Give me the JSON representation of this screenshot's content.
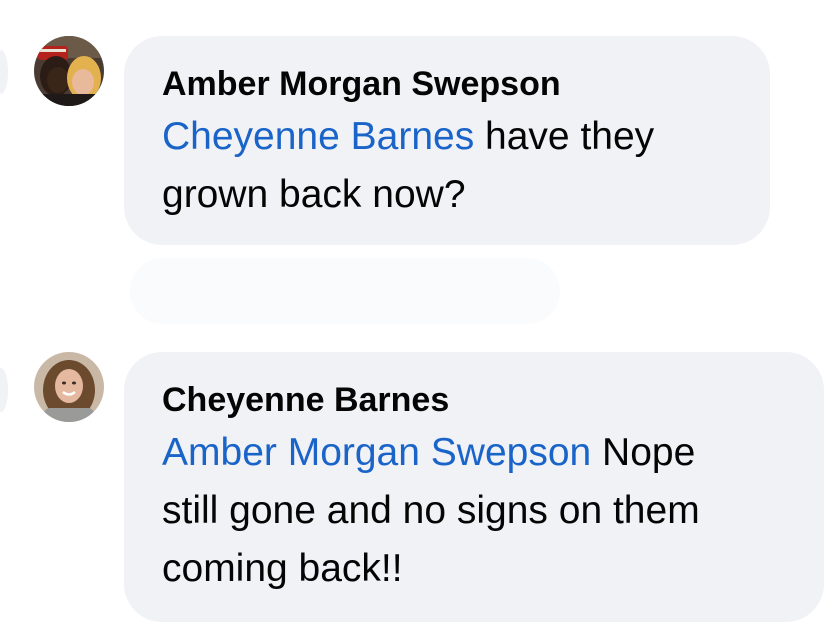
{
  "comments": [
    {
      "author": "Amber Morgan Swepson",
      "avatar_icon": "profile-photo-icon",
      "mention": "Cheyenne Barnes",
      "text_line1_rest": " have they",
      "text_line2": "grown back now?"
    },
    {
      "author": "Cheyenne Barnes",
      "avatar_icon": "profile-photo-icon",
      "mention": "Amber Morgan Swepson",
      "text_line1_rest": " Nope",
      "text_line2": "still gone and no signs on them",
      "text_line3": "coming back!!"
    }
  ],
  "colors": {
    "bubble": "#f0f2f5",
    "mention": "#1a64c9",
    "text": "#050505"
  }
}
